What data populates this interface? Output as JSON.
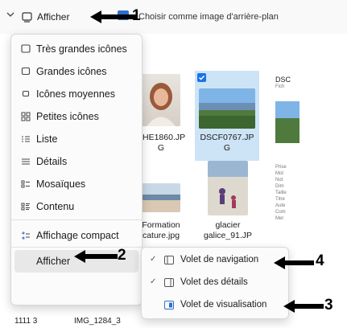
{
  "toolbar": {
    "view_label": "Afficher",
    "background_label": "Choisir comme image d'arrière-plan"
  },
  "menu": {
    "items": [
      {
        "label": "Très grandes icônes",
        "icon": "square-icon"
      },
      {
        "label": "Grandes icônes",
        "icon": "square-icon"
      },
      {
        "label": "Icônes moyennes",
        "icon": "square-icon"
      },
      {
        "label": "Petites icônes",
        "icon": "grid-icon"
      },
      {
        "label": "Liste",
        "icon": "list-icon"
      },
      {
        "label": "Détails",
        "icon": "details-icon"
      },
      {
        "label": "Mosaïques",
        "icon": "tiles-icon"
      },
      {
        "label": "Contenu",
        "icon": "content-icon"
      },
      {
        "label": "Affichage compact",
        "icon": "compact-icon"
      },
      {
        "label": "Afficher",
        "icon": ""
      }
    ]
  },
  "submenu": {
    "items": [
      {
        "label": "Volet de navigation",
        "checked": true
      },
      {
        "label": "Volet des détails",
        "checked": true
      },
      {
        "label": "Volet de visualisation",
        "checked": false
      }
    ]
  },
  "files": [
    {
      "name": "BHE1860.JPG",
      "line1": "BHE1860.JP",
      "line2": "G"
    },
    {
      "name": "DSCF0767.JPG",
      "line1": "DSCF0767.JP",
      "line2": "G"
    },
    {
      "name": "DSC",
      "line1": "DSC",
      "line2": ""
    },
    {
      "name": "Formation cature.jpg",
      "line1": "Formation",
      "line2": "cature.jpg"
    },
    {
      "name": "glacier galice_91.JPG",
      "line1": "glacier",
      "line2": "galice_91.JP"
    }
  ],
  "bottom_files": [
    "1111 3",
    "IMG_1284_3"
  ],
  "side_panel": {
    "header": "DSC",
    "sub": "Fich",
    "labels": [
      "Prise",
      "Mot",
      "Not",
      "Dim",
      "Taille",
      "Titre",
      "Aute",
      "Com",
      "Mer"
    ]
  },
  "callouts": [
    "1",
    "2",
    "3",
    "4"
  ]
}
